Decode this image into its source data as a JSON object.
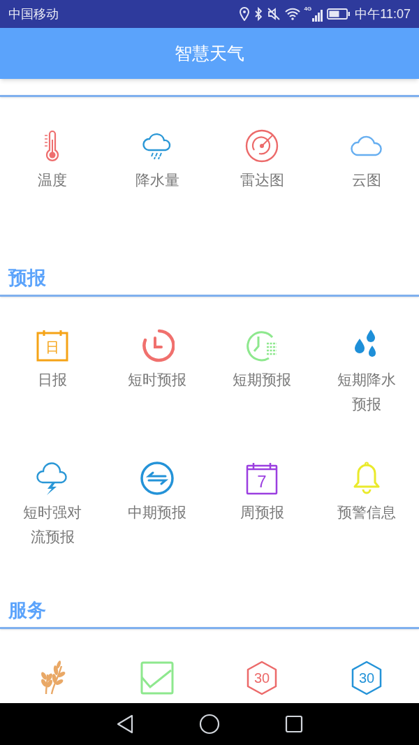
{
  "status_bar": {
    "carrier": "中国移动",
    "network": "4G",
    "time": "中午11:07"
  },
  "app_bar": {
    "title": "智慧天气"
  },
  "sections": [
    {
      "items": [
        {
          "kind": "thermometer",
          "label": "温度"
        },
        {
          "kind": "raincloud",
          "label": "降水量"
        },
        {
          "kind": "radar",
          "label": "雷达图"
        },
        {
          "kind": "cloud",
          "label": "云图"
        }
      ]
    },
    {
      "title": "预报",
      "items": [
        {
          "kind": "calendar",
          "glyph": "日",
          "label": "日报"
        },
        {
          "kind": "clock",
          "label": "短时预报"
        },
        {
          "kind": "clocklist",
          "label": "短期预报"
        },
        {
          "kind": "drops",
          "label": "短期降水预报"
        },
        {
          "kind": "storm",
          "label": "短时强对流预报"
        },
        {
          "kind": "exchange",
          "label": "中期预报"
        },
        {
          "kind": "week",
          "glyph": "7",
          "label": "周预报"
        },
        {
          "kind": "bell",
          "label": "预警信息"
        }
      ]
    },
    {
      "title": "服务",
      "items": [
        {
          "kind": "wheat"
        },
        {
          "kind": "chart"
        },
        {
          "kind": "hexagon",
          "glyph": "30",
          "color": "#ec6a6a"
        },
        {
          "kind": "hexagon",
          "glyph": "30",
          "color": "#2493d8"
        }
      ]
    }
  ]
}
